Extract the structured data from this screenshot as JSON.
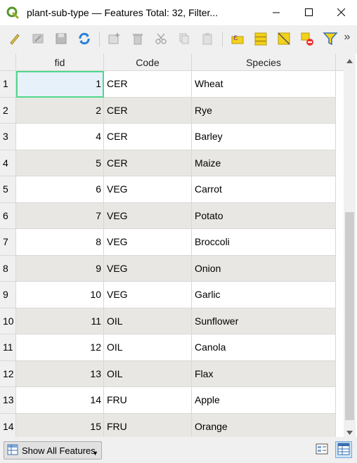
{
  "window": {
    "title": "plant-sub-type — Features Total: 32, Filter...",
    "minimize_icon": "minimize-icon",
    "maximize_icon": "maximize-icon",
    "close_icon": "close-icon"
  },
  "toolbar": {
    "icons": [
      "edit-pencil-icon",
      "multi-edit-icon",
      "save-edits-icon",
      "reload-icon",
      "add-feature-icon",
      "delete-feature-icon",
      "cut-icon",
      "copy-icon",
      "paste-icon",
      "expression-select-icon",
      "select-all-icon",
      "invert-selection-icon",
      "deselect-all-icon",
      "filter-icon"
    ],
    "more": "»"
  },
  "table": {
    "columns": [
      "fid",
      "Code",
      "Species"
    ],
    "rows": [
      {
        "row": "1",
        "fid": "1",
        "code": "CER",
        "species": "Wheat"
      },
      {
        "row": "2",
        "fid": "2",
        "code": "CER",
        "species": "Rye"
      },
      {
        "row": "3",
        "fid": "4",
        "code": "CER",
        "species": "Barley"
      },
      {
        "row": "4",
        "fid": "5",
        "code": "CER",
        "species": "Maize"
      },
      {
        "row": "5",
        "fid": "6",
        "code": "VEG",
        "species": "Carrot"
      },
      {
        "row": "6",
        "fid": "7",
        "code": "VEG",
        "species": "Potato"
      },
      {
        "row": "7",
        "fid": "8",
        "code": "VEG",
        "species": "Broccoli"
      },
      {
        "row": "8",
        "fid": "9",
        "code": "VEG",
        "species": "Onion"
      },
      {
        "row": "9",
        "fid": "10",
        "code": "VEG",
        "species": "Garlic"
      },
      {
        "row": "10",
        "fid": "11",
        "code": "OIL",
        "species": "Sunflower"
      },
      {
        "row": "11",
        "fid": "12",
        "code": "OIL",
        "species": "Canola"
      },
      {
        "row": "12",
        "fid": "13",
        "code": "OIL",
        "species": "Flax"
      },
      {
        "row": "13",
        "fid": "14",
        "code": "FRU",
        "species": "Apple"
      },
      {
        "row": "14",
        "fid": "15",
        "code": "FRU",
        "species": "Orange"
      }
    ]
  },
  "bottom": {
    "show_all_label": "Show All Features"
  },
  "colors": {
    "accent_green": "#4fd98a",
    "alt_row": "#e9e7e3",
    "selected_cell": "#e7f1fa"
  }
}
